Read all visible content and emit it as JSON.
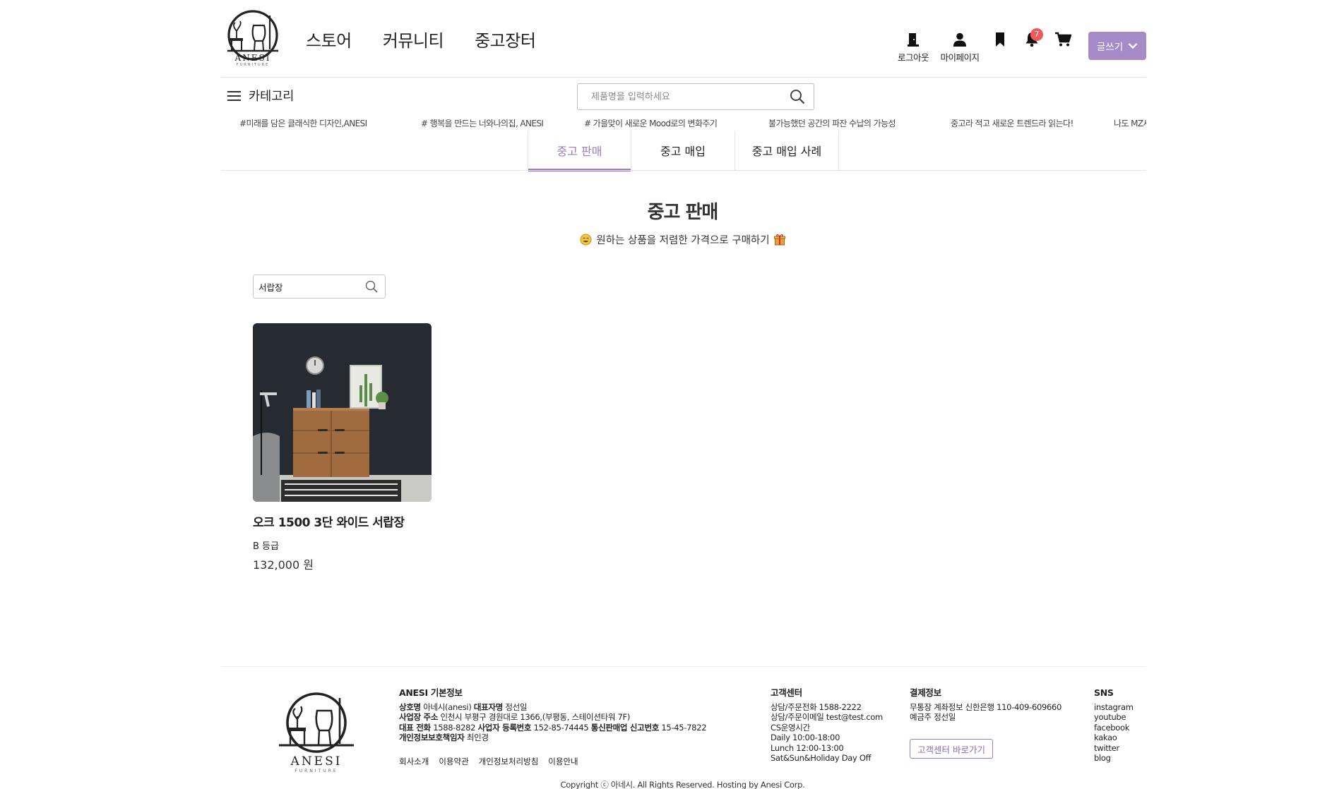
{
  "brand": {
    "name": "ANESI",
    "tagline": "FURNITURE"
  },
  "nav": {
    "items": [
      "스토어",
      "커뮤니티",
      "중고장터"
    ]
  },
  "utility": {
    "logout": "로그아웃",
    "mypage": "마이페이지",
    "notification_count": "7",
    "write_label": "글쓰기"
  },
  "category": {
    "label": "카테고리"
  },
  "search": {
    "placeholder": "제품명을 입력하세요"
  },
  "tags": [
    "#미래를 담은 클래식한 디자인,ANESI",
    "# 행복을 만드는 너와나의집, ANESI",
    "# 가을맞이 새로운 Mood로의 변화주기",
    "불가능했던 공간의 파잔 수납의 가능성",
    "중고라 적고 새로운 트렌드라 읽는다!",
    "나도 MZ세"
  ],
  "tabs": [
    {
      "label": "중고 판매",
      "active": true
    },
    {
      "label": "중고 매입",
      "active": false
    },
    {
      "label": "중고 매입 사례",
      "active": false
    }
  ],
  "page": {
    "title": "중고 판매",
    "subtitle": "원하는 상품을 저렴한 가격으로 구매하기",
    "search_value": "서랍장"
  },
  "products": [
    {
      "name": "오크 1500 3단 와이드 서랍장",
      "grade": "B 등급",
      "price": "132,000 원"
    }
  ],
  "footer": {
    "info": {
      "title": "ANESI 기본정보",
      "company_label": "상호명",
      "company": "아네시(anesi)",
      "ceo_label": "대표자명",
      "ceo": "정선일",
      "address_label": "사업장 주소",
      "address": "인천시 부평구 경원대로 1366,(부평동, 스테이션타워 7F)",
      "phone_label": "대표 전화",
      "phone": "1588-8282",
      "bizno_label": "사업자 등록번호",
      "bizno": "152-85-74445",
      "mail_order_label": "통신판매업 신고번호",
      "mail_order": "15-45-7822",
      "privacy_officer_label": "개인정보보호책임자",
      "privacy_officer": "최인경"
    },
    "links": [
      "회사소개",
      "이용약관",
      "개인정보처리방침",
      "이용안내"
    ],
    "cs": {
      "title": "고객센터",
      "lines": [
        "상담/주문전화 1588-2222",
        "상담/주문이메일 test@test.com",
        "CS운영시간",
        "Daily 10:00-18:00",
        "Lunch 12:00-13:00",
        "Sat&Sun&Holiday Day Off"
      ]
    },
    "payment": {
      "title": "결제정보",
      "lines": [
        "무통장 계좌정보 신한은행 110-409-609660",
        "예금주 정선일"
      ],
      "button": "고객센터 바로가기"
    },
    "sns": {
      "title": "SNS",
      "items": [
        "instagram",
        "youtube",
        "facebook",
        "kakao",
        "twitter",
        "blog"
      ]
    },
    "copyright": "Copyright ⓒ 아네시. All Rights Reserved. Hosting by Anesi Corp."
  },
  "colors": {
    "accent": "#9b7cc6",
    "button": "#a68bc9",
    "badge": "#f15a5a"
  }
}
